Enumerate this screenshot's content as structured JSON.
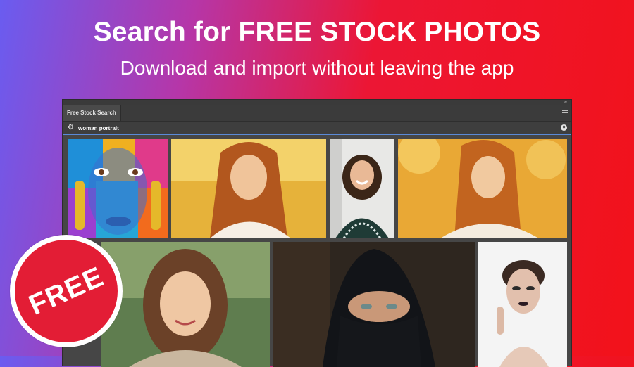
{
  "hero": {
    "title": "Search for FREE STOCK PHOTOS",
    "subtitle": "Download and import without leaving the app"
  },
  "panel": {
    "tab_label": "Free Stock Search",
    "menu_icon": "hamburger-menu-icon",
    "collapse_icon": "double-chevron-icon"
  },
  "search": {
    "query": "woman portrait",
    "settings_icon": "gear-icon",
    "clear_icon": "clear-icon"
  },
  "results": [
    {
      "subject": "colorful painted face"
    },
    {
      "subject": "woman in warm light"
    },
    {
      "subject": "smiling woman"
    },
    {
      "subject": "woman with closed eyes"
    },
    {
      "subject": "woman outdoors"
    },
    {
      "subject": "woman in hijab"
    },
    {
      "subject": "woman dark lipstick"
    }
  ],
  "badge": {
    "label": "FREE"
  },
  "colors": {
    "gradient_start": "#6a5cf0",
    "gradient_end": "#f2121a",
    "badge": "#e31d35",
    "panel": "#464646",
    "search_underline": "#5a8ad8"
  }
}
